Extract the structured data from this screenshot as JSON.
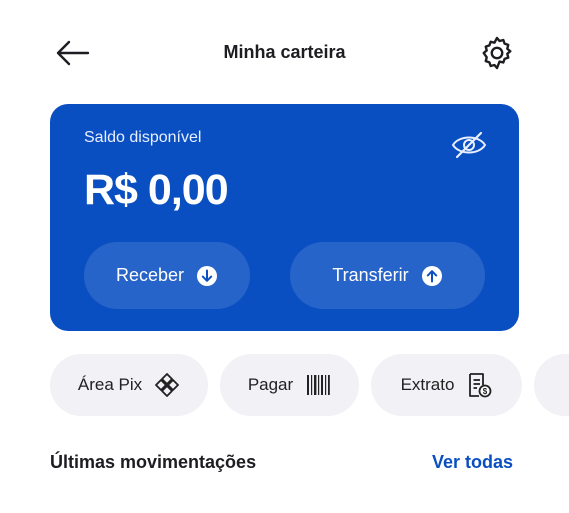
{
  "header": {
    "title": "Minha carteira",
    "back_icon": "arrow-left-icon",
    "settings_icon": "gear-icon"
  },
  "wallet_card": {
    "label": "Saldo disponível",
    "balance": "R$ 0,00",
    "visibility_icon": "eye-off-icon",
    "receive_label": "Receber",
    "receive_icon": "arrow-down-circle-icon",
    "transfer_label": "Transferir",
    "transfer_icon": "arrow-up-circle-icon",
    "color": "#0a4fc2"
  },
  "shortcuts": [
    {
      "label": "Área Pix",
      "icon": "pix-icon"
    },
    {
      "label": "Pagar",
      "icon": "barcode-icon"
    },
    {
      "label": "Extrato",
      "icon": "statement-icon"
    }
  ],
  "movements": {
    "title": "Últimas movimentações",
    "see_all": "Ver todas"
  },
  "colors": {
    "accent": "#0a4fc2",
    "chip_bg": "#f1f1f6"
  }
}
